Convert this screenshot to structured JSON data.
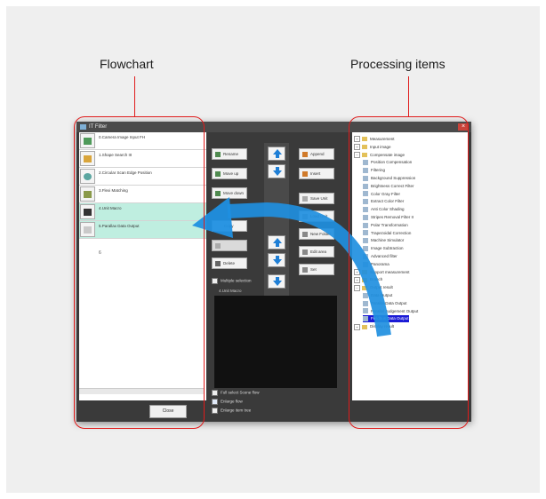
{
  "callouts": {
    "left": "Flowchart",
    "right": "Processing items"
  },
  "window": {
    "title": "IT Filter",
    "close_glyph": "×"
  },
  "flowchart": {
    "items": [
      {
        "label": "0.Camera Image Input FH"
      },
      {
        "label": "1.Shape Search III"
      },
      {
        "label": "2.Circular Scan Edge Position"
      },
      {
        "label": "3.Flexi Matching"
      },
      {
        "label": "4.Unit Macro"
      },
      {
        "label": "5.Parallax Data Output"
      }
    ],
    "end_index": "6",
    "close_label": "Close"
  },
  "buttons": {
    "rename": "Rename",
    "move_up": "Move up",
    "move_down": "Move down",
    "copy": "Copy",
    "delete": "Delete",
    "append": "Append",
    "insert": "Insert",
    "save_unit": "Save Unit",
    "load_unit": "Load Unit",
    "new_folder": "New Folder",
    "edit_area": "Edit area",
    "set": "Set"
  },
  "options": {
    "multiple_selection": "Multiple selection",
    "preview_label": "4.Unit Macro",
    "full_select_scene_flow": "Full select Scene flow",
    "enlarge_flow": "Enlarge flow",
    "enlarge_item_tree": "Enlarge item tree"
  },
  "tree": [
    {
      "text": "Measurement",
      "kind": "folder",
      "pm": "+",
      "level": 0
    },
    {
      "text": "Input image",
      "kind": "folder",
      "pm": "+",
      "level": 0
    },
    {
      "text": "Compensate image",
      "kind": "folder",
      "pm": "−",
      "level": 0
    },
    {
      "text": "Position Compensation",
      "kind": "item",
      "level": 1
    },
    {
      "text": "Filtering",
      "kind": "item",
      "level": 1
    },
    {
      "text": "Background Suppression",
      "kind": "item",
      "level": 1
    },
    {
      "text": "Brightness Correct Filter",
      "kind": "item",
      "level": 1
    },
    {
      "text": "Color Gray Filter",
      "kind": "item",
      "level": 1
    },
    {
      "text": "Extract Color Filter",
      "kind": "item",
      "level": 1
    },
    {
      "text": "Anti Color Shading",
      "kind": "item",
      "level": 1
    },
    {
      "text": "Stripes Removal Filter II",
      "kind": "item",
      "level": 1
    },
    {
      "text": "Polar Transformation",
      "kind": "item",
      "level": 1
    },
    {
      "text": "Trapezoidal Correction",
      "kind": "item",
      "level": 1
    },
    {
      "text": "Machine Simulator",
      "kind": "item",
      "level": 1
    },
    {
      "text": "Image Subtraction",
      "kind": "item",
      "level": 1
    },
    {
      "text": "Advanced filter",
      "kind": "item",
      "level": 1
    },
    {
      "text": "Panorama",
      "kind": "item",
      "level": 1
    },
    {
      "text": "Support measurement",
      "kind": "folder",
      "pm": "+",
      "level": 0
    },
    {
      "text": "Branch",
      "kind": "folder",
      "pm": "+",
      "level": 0
    },
    {
      "text": "Output result",
      "kind": "folder",
      "pm": "−",
      "level": 0
    },
    {
      "text": "Data Output",
      "kind": "item",
      "level": 1
    },
    {
      "text": "Parallel Data Output",
      "kind": "item",
      "level": 1
    },
    {
      "text": "Parallel Judgement Output",
      "kind": "item",
      "level": 1
    },
    {
      "text": "Fieldbus Data Output",
      "kind": "item",
      "level": 1,
      "selected": true
    },
    {
      "text": "Display result",
      "kind": "folder",
      "pm": "+",
      "level": 0
    }
  ],
  "colors": {
    "highlight": "#e01b1b",
    "arrow": "#1f8fe0",
    "selected_row": "#bfeee0",
    "tree_selection": "#1b1bd6"
  }
}
